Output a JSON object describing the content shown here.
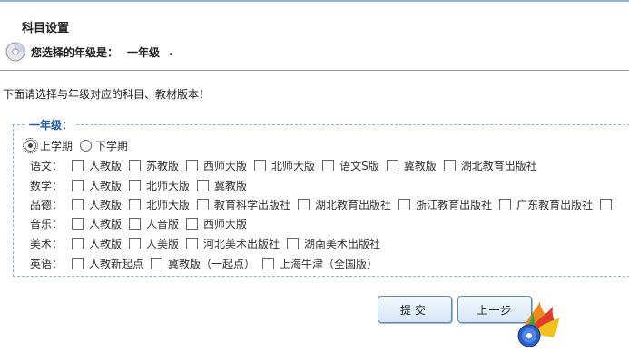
{
  "page": {
    "title": "科目设置",
    "grade_label": "您选择的年级是：",
    "grade_value": "一年级",
    "grade_suffix": ".",
    "instruction": "下面请选择与年级对应的科目、教材版本！"
  },
  "form": {
    "legend": "一年级：",
    "terms": [
      {
        "label": "上学期",
        "checked": true
      },
      {
        "label": "下学期",
        "checked": false
      }
    ],
    "subjects": [
      {
        "label": "语文：",
        "options": [
          "人教版",
          "苏教版",
          "西师大版",
          "北师大版",
          "语文S版",
          "冀教版",
          "湖北教育出版社"
        ]
      },
      {
        "label": "数学：",
        "options": [
          "人教版",
          "北师大版",
          "冀教版"
        ]
      },
      {
        "label": "品德：",
        "options": [
          "人教版",
          "北师大版",
          "教育科学出版社",
          "湖北教育出版社",
          "浙江教育出版社",
          "广东教育出版社",
          ""
        ]
      },
      {
        "label": "音乐：",
        "options": [
          "人教版",
          "人音版",
          "西师大版"
        ]
      },
      {
        "label": "美术：",
        "options": [
          "人教版",
          "人美版",
          "河北美术出版社",
          "湖南美术出版社"
        ]
      },
      {
        "label": "英语：",
        "options": [
          "人教新起点",
          "冀教版（一起点）",
          "上海牛津（全国版）"
        ]
      }
    ]
  },
  "buttons": {
    "submit": "提交",
    "prev": "上一步"
  },
  "colors": {
    "accent": "#1c5ca8",
    "border": "#8fb4cf"
  }
}
